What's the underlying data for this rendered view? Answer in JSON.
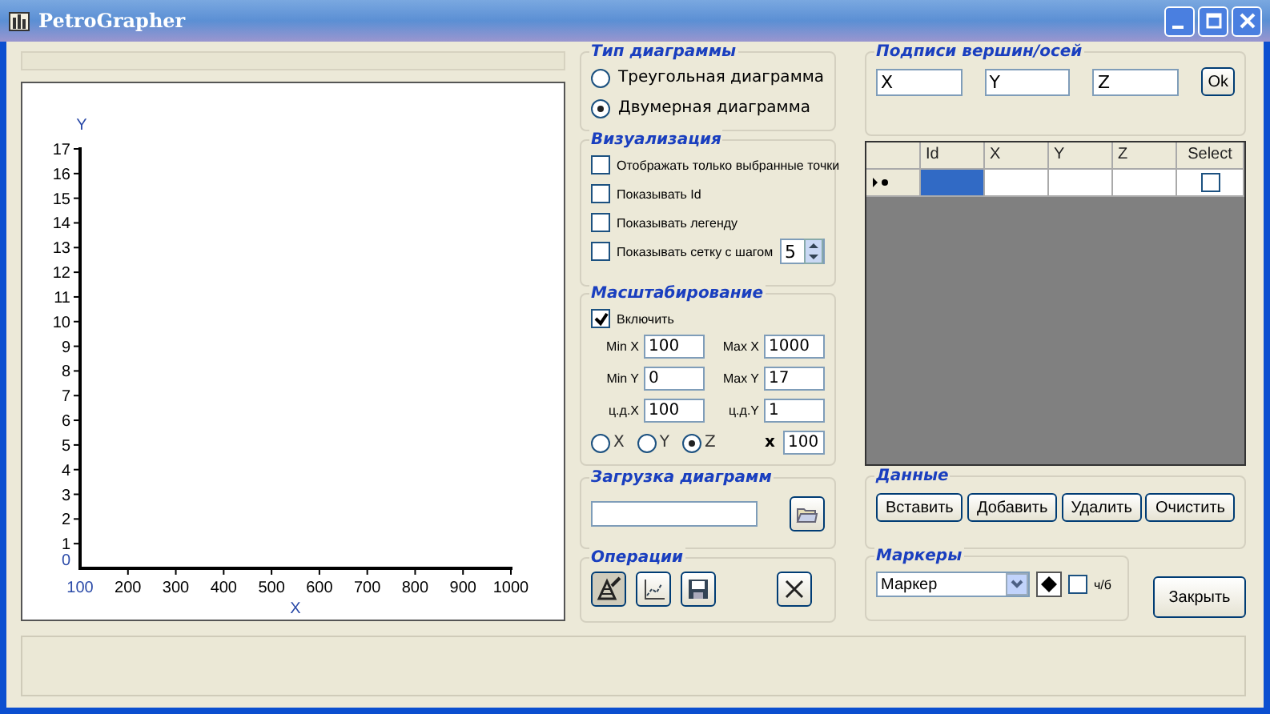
{
  "window": {
    "title": "PetroGrapher"
  },
  "chart": {
    "chart_data": {
      "type": "scatter",
      "xlabel": "X",
      "ylabel": "Y",
      "xlim": [
        100,
        1000
      ],
      "ylim": [
        0,
        17
      ],
      "xticks": [
        100,
        200,
        300,
        400,
        500,
        600,
        700,
        800,
        900,
        1000
      ],
      "yticks": [
        0,
        1,
        2,
        3,
        4,
        5,
        6,
        7,
        8,
        9,
        10,
        11,
        12,
        13,
        14,
        15,
        16,
        17
      ]
    }
  },
  "diagram_type": {
    "title": "Тип диаграммы",
    "options": [
      {
        "label": "Треугольная диаграмма",
        "selected": false
      },
      {
        "label": "Двумерная диаграмма",
        "selected": true
      }
    ]
  },
  "visualization": {
    "title": "Визуализация",
    "items": [
      {
        "kind": "check",
        "label": "Отображать только выбранные точки",
        "checked": false
      },
      {
        "kind": "check",
        "label": "Показывать Id",
        "checked": false
      },
      {
        "kind": "check",
        "label": "Показывать легенду",
        "checked": false
      },
      {
        "kind": "spin",
        "label": "Показывать сетку с шагом",
        "checked": false,
        "value": "5"
      }
    ]
  },
  "scaling": {
    "title": "Масштабирование",
    "enable": {
      "label": "Включить",
      "checked": true
    },
    "fields": [
      {
        "label": "Min X",
        "value": "100"
      },
      {
        "label": "Max X",
        "value": "1000"
      },
      {
        "label": "Min Y",
        "value": "0"
      },
      {
        "label": "Max Y",
        "value": "17"
      },
      {
        "label": "ц.д.X",
        "value": "100"
      },
      {
        "label": "ц.д.Y",
        "value": "1"
      }
    ],
    "axes": [
      {
        "label": "X",
        "selected": false
      },
      {
        "label": "Y",
        "selected": false
      },
      {
        "label": "Z",
        "selected": true
      }
    ],
    "factor": {
      "label": "x",
      "value": "100"
    }
  },
  "loading": {
    "title": "Загрузка диаграмм"
  },
  "operations": {
    "title": "Операции"
  },
  "labels": {
    "title": "Подписи вершин/осей",
    "fields": [
      "X",
      "Y",
      "Z"
    ],
    "ok": "Ok"
  },
  "grid": {
    "columns": [
      "Id",
      "X",
      "Y",
      "Z",
      "Select"
    ],
    "new_row": {
      "cells": [
        {
          "selected": true
        },
        {
          "selected": false
        },
        {
          "selected": false
        },
        {
          "selected": false
        }
      ],
      "checked": false
    }
  },
  "data": {
    "title": "Данные",
    "buttons": [
      "Вставить",
      "Добавить",
      "Удалить",
      "Очистить"
    ]
  },
  "markers": {
    "title": "Маркеры",
    "dropdown": "Маркер",
    "bw": {
      "label": "ч/б",
      "checked": false
    }
  },
  "close_button": "Закрыть"
}
